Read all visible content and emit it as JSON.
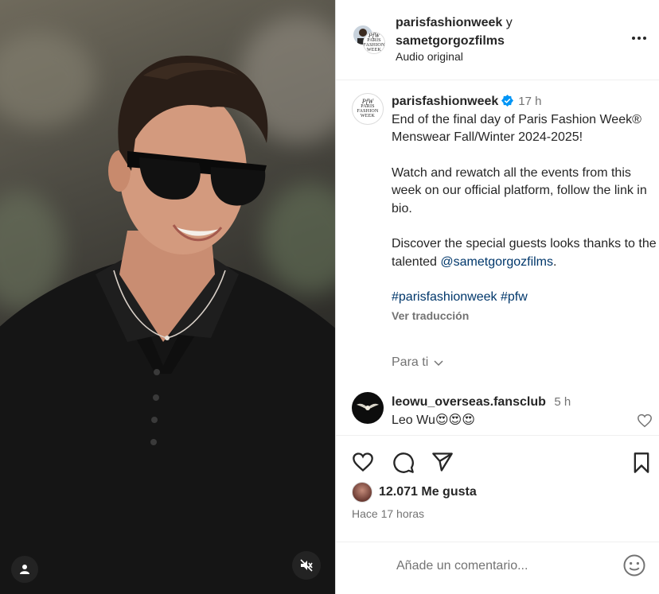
{
  "header": {
    "user1": "parisfashionweek",
    "joiner": "y",
    "user2": "sametgorgozfilms",
    "audio": "Audio original"
  },
  "logo": {
    "mark": "PfW",
    "line1": "PARIS",
    "line2": "FASHION",
    "line3": "WEEK"
  },
  "caption": {
    "username": "parisfashionweek",
    "time": "17 h",
    "p1": "End of the final day of Paris Fashion Week® Menswear Fall/Winter 2024-2025!",
    "p2": "Watch and rewatch all the events from this week on our official platform, follow the link in bio.",
    "p3_text": "Discover the special guests looks thanks to the talented ",
    "p3_mention": "@sametgorgozfilms",
    "p3_end": ".",
    "tag1": "#parisfashionweek",
    "tag2": "#pfw",
    "see_translation": "Ver traducción",
    "for_you": "Para ti"
  },
  "comment": {
    "username": "leowu_overseas.fansclub",
    "time": "5 h",
    "text": "Leo Wu😍😍😍"
  },
  "likes": {
    "count": "12.071 Me gusta",
    "time_ago": "Hace 17 horas"
  },
  "add_comment": {
    "placeholder": "Añade un comentario..."
  },
  "icons": [
    "heart-icon",
    "comment-icon",
    "share-icon",
    "bookmark-icon",
    "emoji-icon",
    "more-icon",
    "mute-icon",
    "user-tag-icon",
    "verified-icon",
    "chevron-down-icon"
  ],
  "colors": {
    "verified": "#0095f6",
    "link": "#00376b",
    "secondary_text": "#737373",
    "border": "#dbdbdb"
  }
}
